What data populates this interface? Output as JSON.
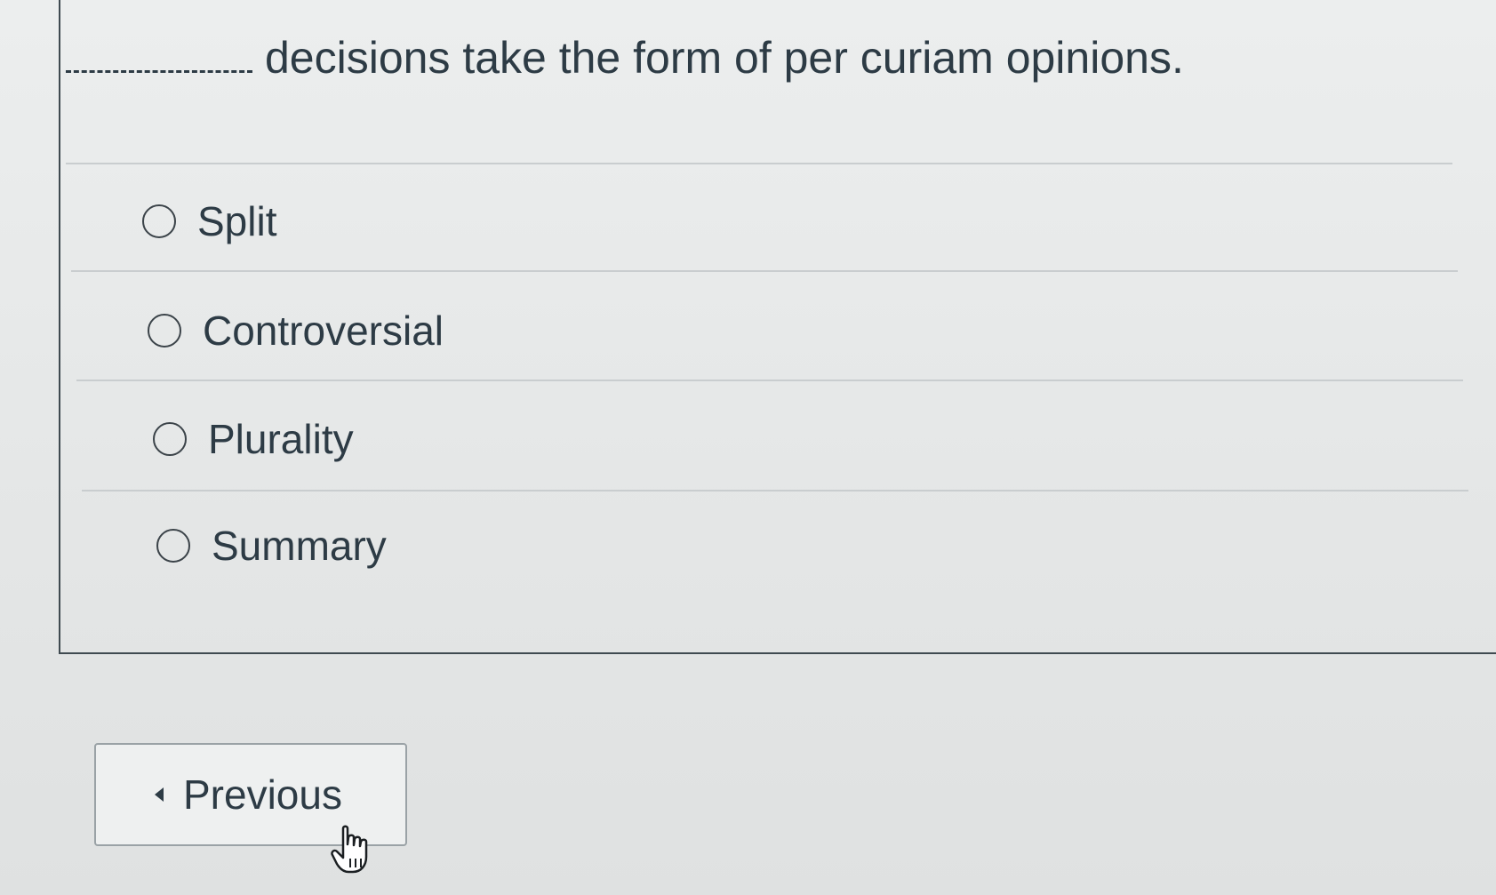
{
  "question": {
    "blank": "_________",
    "text": "decisions take the form of per curiam opinions."
  },
  "options": [
    {
      "label": "Split",
      "selected": false
    },
    {
      "label": "Controversial",
      "selected": false
    },
    {
      "label": "Plurality",
      "selected": false
    },
    {
      "label": "Summary",
      "selected": false
    }
  ],
  "navigation": {
    "previous_label": "Previous",
    "previous_icon": "caret-left-icon"
  },
  "cursor_icon": "hand-pointer-icon"
}
